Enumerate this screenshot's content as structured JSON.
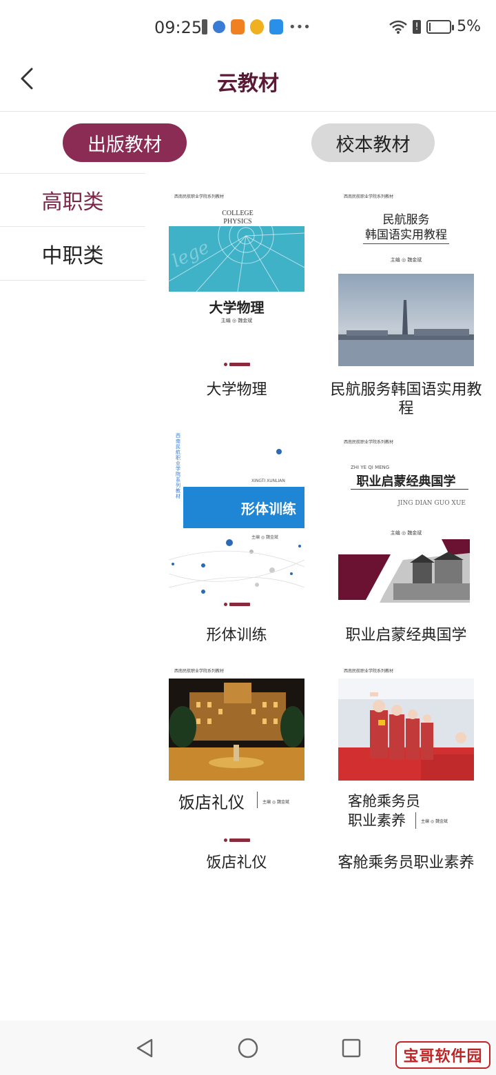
{
  "status_bar": {
    "time": "09:25",
    "battery_percent": "5%",
    "battery_level": 0.05
  },
  "header": {
    "title": "云教材"
  },
  "tabs": {
    "active": "出版教材",
    "inactive": "校本教材"
  },
  "categories": [
    "高职类",
    "中职类"
  ],
  "books": [
    {
      "title": "大学物理",
      "cover": {
        "series": "西南民航职业学院系列教材",
        "english": "COLLEGE PHYSICS",
        "main_title": "大学物理",
        "editor": "主编 ◎ 魏金斌"
      }
    },
    {
      "title": "民航服务韩国语实用教程",
      "cover": {
        "series": "西南民航职业学院系列教材",
        "main_title_line1": "民航服务",
        "main_title_line2": "韩国语实用教程",
        "editor": "主编 ◎ 魏金斌"
      }
    },
    {
      "title": "形体训练",
      "cover": {
        "series": "西南民航职业学院系列教材",
        "pinyin": "XINGTI XUNLIAN",
        "main_title": "形体训练",
        "editor": "主编 ◎ 魏金斌"
      }
    },
    {
      "title": "职业启蒙经典国学",
      "cover": {
        "series": "西南民航职业学院系列教材",
        "pinyin_top": "ZHI YE QI MENG",
        "main_title": "职业启蒙经典国学",
        "pinyin_bottom": "JING DIAN GUO XUE",
        "editor": "主编 ◎ 魏金斌"
      }
    },
    {
      "title": "饭店礼仪",
      "cover": {
        "series": "西南民航职业学院系列教材",
        "main_title": "饭店礼仪",
        "editor": "主编 ◎ 魏金斌"
      }
    },
    {
      "title": "客舱乘务员职业素养",
      "cover": {
        "series": "西南民航职业学院系列教材",
        "main_title_line1": "客舱乘务员",
        "main_title_line2": "职业素养",
        "editor": "主编 ◎ 魏金斌"
      }
    }
  ],
  "watermark": "宝哥软件园",
  "colors": {
    "accent": "#8b2c55",
    "title": "#5a1a35",
    "category_active": "#7b2545",
    "tab_inactive_bg": "#d9d9d9"
  },
  "icons": [
    "back-arrow-icon",
    "back-triangle-icon",
    "home-circle-icon",
    "recents-square-icon",
    "wifi-icon",
    "battery-icon"
  ]
}
